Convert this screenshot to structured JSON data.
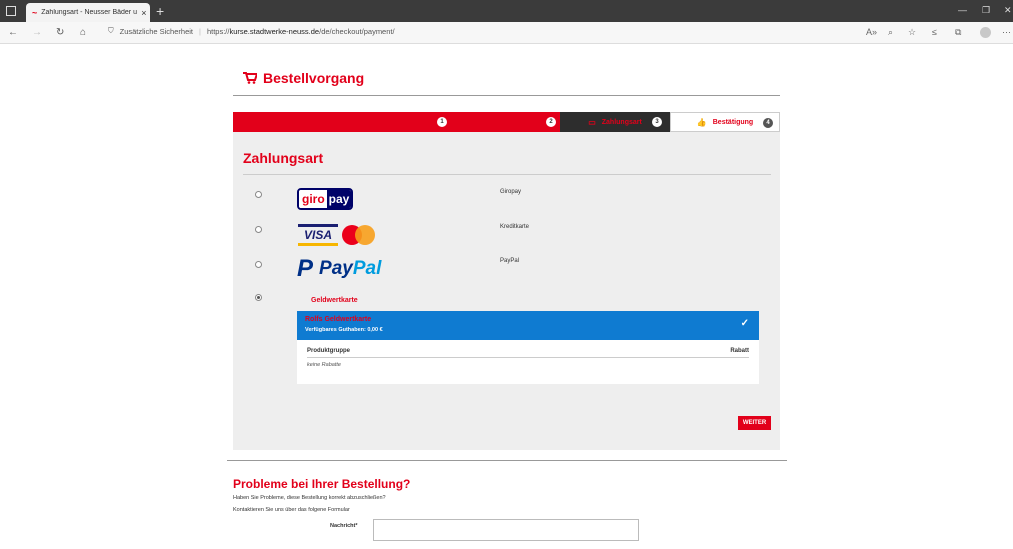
{
  "browser": {
    "tab_title": "Zahlungsart - Neusser Bäder und",
    "tab_close": "×",
    "new_tab": "+",
    "security_text": "Zusätzliche Sicherheit",
    "url_prefix": "https://",
    "url_host": "kurse.stadtwerke-neuss.de",
    "url_path": "/de/checkout/payment/",
    "controls": {
      "minimize": "—",
      "restore": "❐",
      "close": "✕"
    }
  },
  "page": {
    "title": "Bestellvorgang",
    "steps": [
      {
        "num": "1",
        "label": ""
      },
      {
        "num": "2",
        "label": ""
      },
      {
        "num": "3",
        "label": "Zahlungsart"
      },
      {
        "num": "4",
        "label": "Bestätigung"
      }
    ],
    "section_title": "Zahlungsart",
    "payment_options": [
      {
        "name": "Giropay",
        "logo": "giropay-logo",
        "selected": false
      },
      {
        "name": "Kreditkarte",
        "logo": "visa-mastercard-logo",
        "selected": false
      },
      {
        "name": "PayPal",
        "logo": "paypal-logo",
        "selected": false
      },
      {
        "name": "Geldwertkarte",
        "selected": true
      }
    ],
    "logos": {
      "giro": "giro",
      "pay": "pay",
      "visa": "VISA",
      "paypal_pay": "Pay",
      "paypal_pal": "Pal"
    },
    "card": {
      "name": "Rolfs Geldwertkarte",
      "balance": "Verfügbares Guthaben: 0,00 €",
      "check": "✓",
      "col_group": "Produktgruppe",
      "col_discount": "Rabatt",
      "empty": "keine Rabatte"
    },
    "weiter_label": "WEITER",
    "problems": {
      "title": "Probleme bei Ihrer Bestellung?",
      "line1": "Haben Sie Probleme, diese Bestellung korrekt abzuschließen?",
      "line2": "Kontaktieren Sie uns über das folgene Formular",
      "message_label": "Nachricht*"
    }
  },
  "colors": {
    "brand_red": "#e2001a",
    "card_blue": "#0f7bd1",
    "dark_step": "#2d2d2d"
  }
}
